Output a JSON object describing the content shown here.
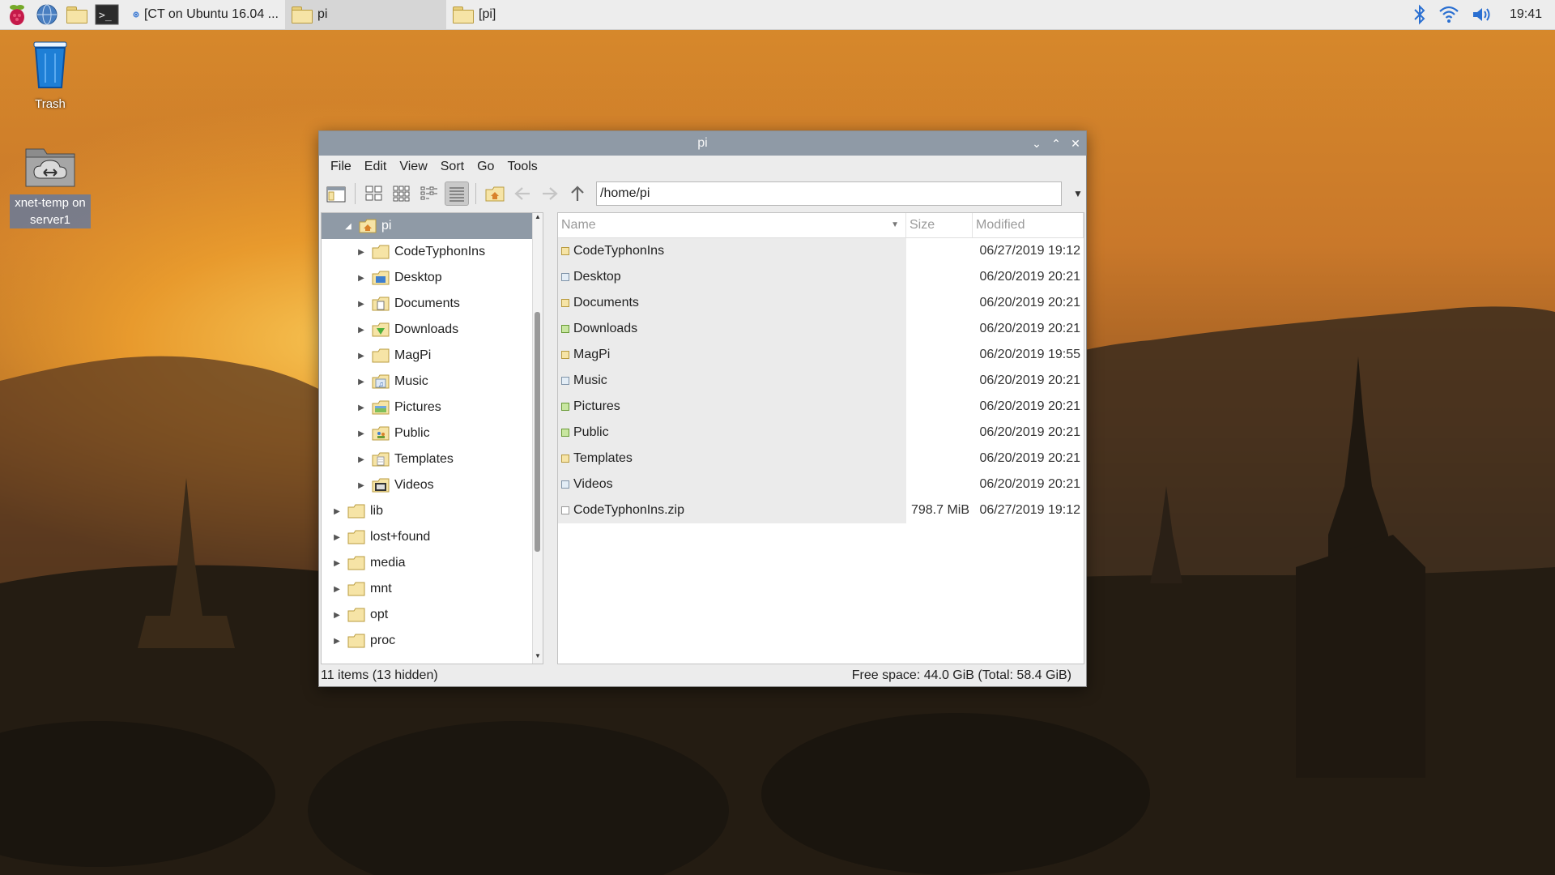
{
  "taskbar": {
    "launchers": [
      "raspberry-menu-icon",
      "web-browser-icon",
      "file-manager-icon",
      "terminal-icon"
    ],
    "tasks": [
      {
        "label": "[CT on Ubuntu 16.04 ...",
        "icon": "chromium-icon",
        "active": false
      },
      {
        "label": "pi",
        "icon": "folder-icon",
        "active": true
      },
      {
        "label": "[pi]",
        "icon": "folder-icon",
        "active": false
      }
    ],
    "tray": {
      "icons": [
        "bluetooth-icon",
        "wifi-icon",
        "volume-icon"
      ],
      "clock": "19:41"
    }
  },
  "desktop": {
    "icons": [
      {
        "label": "Trash",
        "icon": "trash-icon"
      },
      {
        "label": "xnet-temp on server1",
        "icon": "network-share-icon"
      }
    ]
  },
  "window": {
    "title": "pi",
    "menu": [
      "File",
      "Edit",
      "View",
      "Sort",
      "Go",
      "Tools"
    ],
    "toolbar": {
      "buttons": [
        "new-window-icon",
        "icon-view-icon",
        "thumbnail-view-icon",
        "compact-view-icon",
        "detailed-list-view-icon",
        "home-icon",
        "back-icon",
        "forward-icon",
        "up-icon"
      ],
      "path": "/home/pi"
    },
    "tree": {
      "root": {
        "label": "pi",
        "expanded": true
      },
      "children": [
        "CodeTyphonIns",
        "Desktop",
        "Documents",
        "Downloads",
        "MagPi",
        "Music",
        "Pictures",
        "Public",
        "Templates",
        "Videos"
      ],
      "siblings": [
        "lib",
        "lost+found",
        "media",
        "mnt",
        "opt",
        "proc"
      ]
    },
    "columns": {
      "name": "Name",
      "size": "Size",
      "modified": "Modified"
    },
    "files": [
      {
        "name": "CodeTyphonIns",
        "size": "",
        "modified": "06/27/2019 19:12"
      },
      {
        "name": "Desktop",
        "size": "",
        "modified": "06/20/2019 20:21"
      },
      {
        "name": "Documents",
        "size": "",
        "modified": "06/20/2019 20:21"
      },
      {
        "name": "Downloads",
        "size": "",
        "modified": "06/20/2019 20:21"
      },
      {
        "name": "MagPi",
        "size": "",
        "modified": "06/20/2019 19:55"
      },
      {
        "name": "Music",
        "size": "",
        "modified": "06/20/2019 20:21"
      },
      {
        "name": "Pictures",
        "size": "",
        "modified": "06/20/2019 20:21"
      },
      {
        "name": "Public",
        "size": "",
        "modified": "06/20/2019 20:21"
      },
      {
        "name": "Templates",
        "size": "",
        "modified": "06/20/2019 20:21"
      },
      {
        "name": "Videos",
        "size": "",
        "modified": "06/20/2019 20:21"
      },
      {
        "name": "CodeTyphonIns.zip",
        "size": "798.7 MiB",
        "modified": "06/27/2019 19:12"
      }
    ],
    "status": {
      "left": "11 items (13 hidden)",
      "right": "Free space: 44.0 GiB (Total: 58.4 GiB)"
    }
  },
  "colors": {
    "titlebar": "#8f9aa6",
    "taskbar": "#ededed",
    "selection": "#8f9aa6"
  }
}
